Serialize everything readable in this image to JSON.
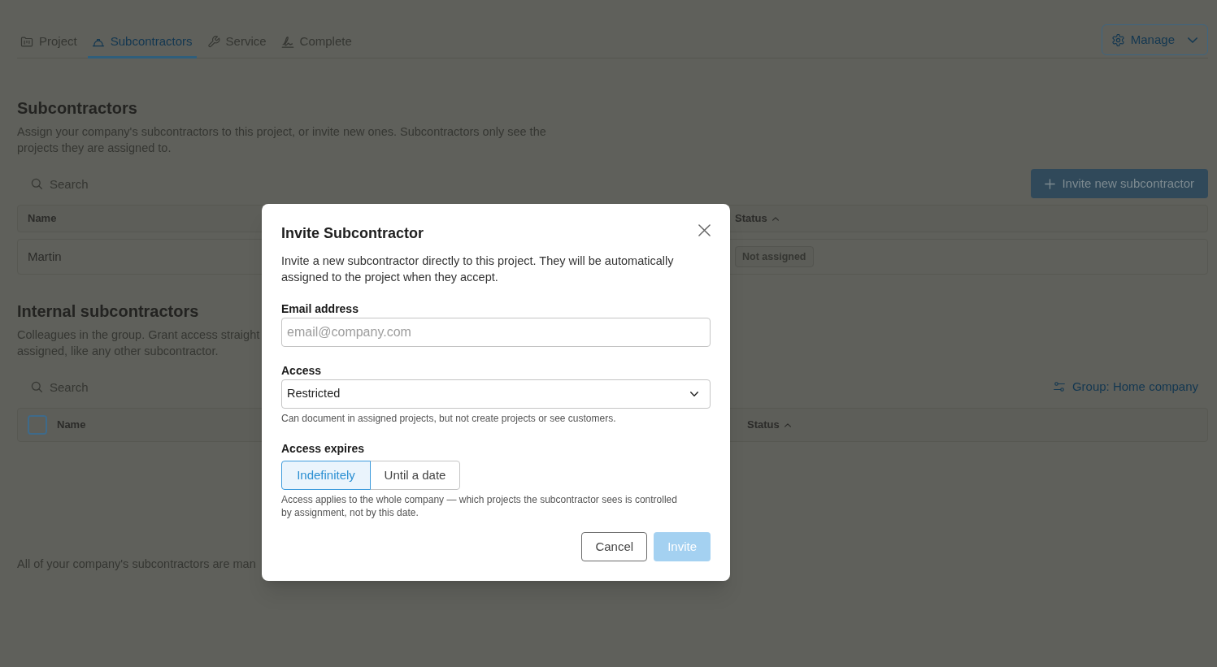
{
  "tabs": [
    {
      "label": "Project",
      "selected": false
    },
    {
      "label": "Subcontractors",
      "selected": true
    },
    {
      "label": "Service",
      "selected": false
    },
    {
      "label": "Complete",
      "selected": false
    }
  ],
  "manage_button": {
    "label": "Manage"
  },
  "subcontractors": {
    "title": "Subcontractors",
    "description": "Assign your company's subcontractors to this project, or invite new ones. Subcontractors only see the projects they are assigned to.",
    "search": {
      "placeholder": "Search"
    },
    "invite_button": {
      "label": "Invite new subcontractor"
    },
    "table": {
      "columns": [
        {
          "label": "Name",
          "sorted": false
        },
        {
          "label": "Status",
          "sorted": true
        }
      ],
      "rows": [
        {
          "name": "Martin",
          "status": "Not assigned"
        }
      ]
    }
  },
  "internal_subcontractors": {
    "title": "Internal subcontractors",
    "description_lines": [
      "Colleagues in the group. Grant access straight",
      "assigned, like any other subcontractor."
    ],
    "search": {
      "placeholder": "Search"
    },
    "group_filter": {
      "label": "Group: Home company"
    },
    "table": {
      "select_all": {
        "checked": false
      },
      "columns": [
        {
          "label": "Name",
          "sorted": false
        },
        {
          "label": "Status",
          "sorted": true
        }
      ]
    }
  },
  "footer_note": "All of your company's subcontractors are man",
  "dialog": {
    "title": "Invite Subcontractor",
    "description": "Invite a new subcontractor directly to this project. They will be automatically assigned to the project when they accept.",
    "fields": [
      {
        "kind": "text",
        "label": "Email address",
        "placeholder": "email@company.com"
      },
      {
        "kind": "select",
        "label": "Access",
        "value": "Restricted",
        "help": "Can document in assigned projects, but not create projects or see customers."
      },
      {
        "kind": "segmented",
        "label": "Access expires",
        "options": [
          {
            "label": "Indefinitely",
            "selected": true
          },
          {
            "label": "Until a date",
            "selected": false
          }
        ],
        "help": "Access applies to the whole company — which projects the subcontractor sees is controlled by assignment, not by this date."
      }
    ],
    "buttons": [
      {
        "kind": "secondary",
        "label": "Cancel",
        "disabled": false
      },
      {
        "kind": "primary",
        "label": "Invite",
        "disabled": true
      }
    ]
  }
}
